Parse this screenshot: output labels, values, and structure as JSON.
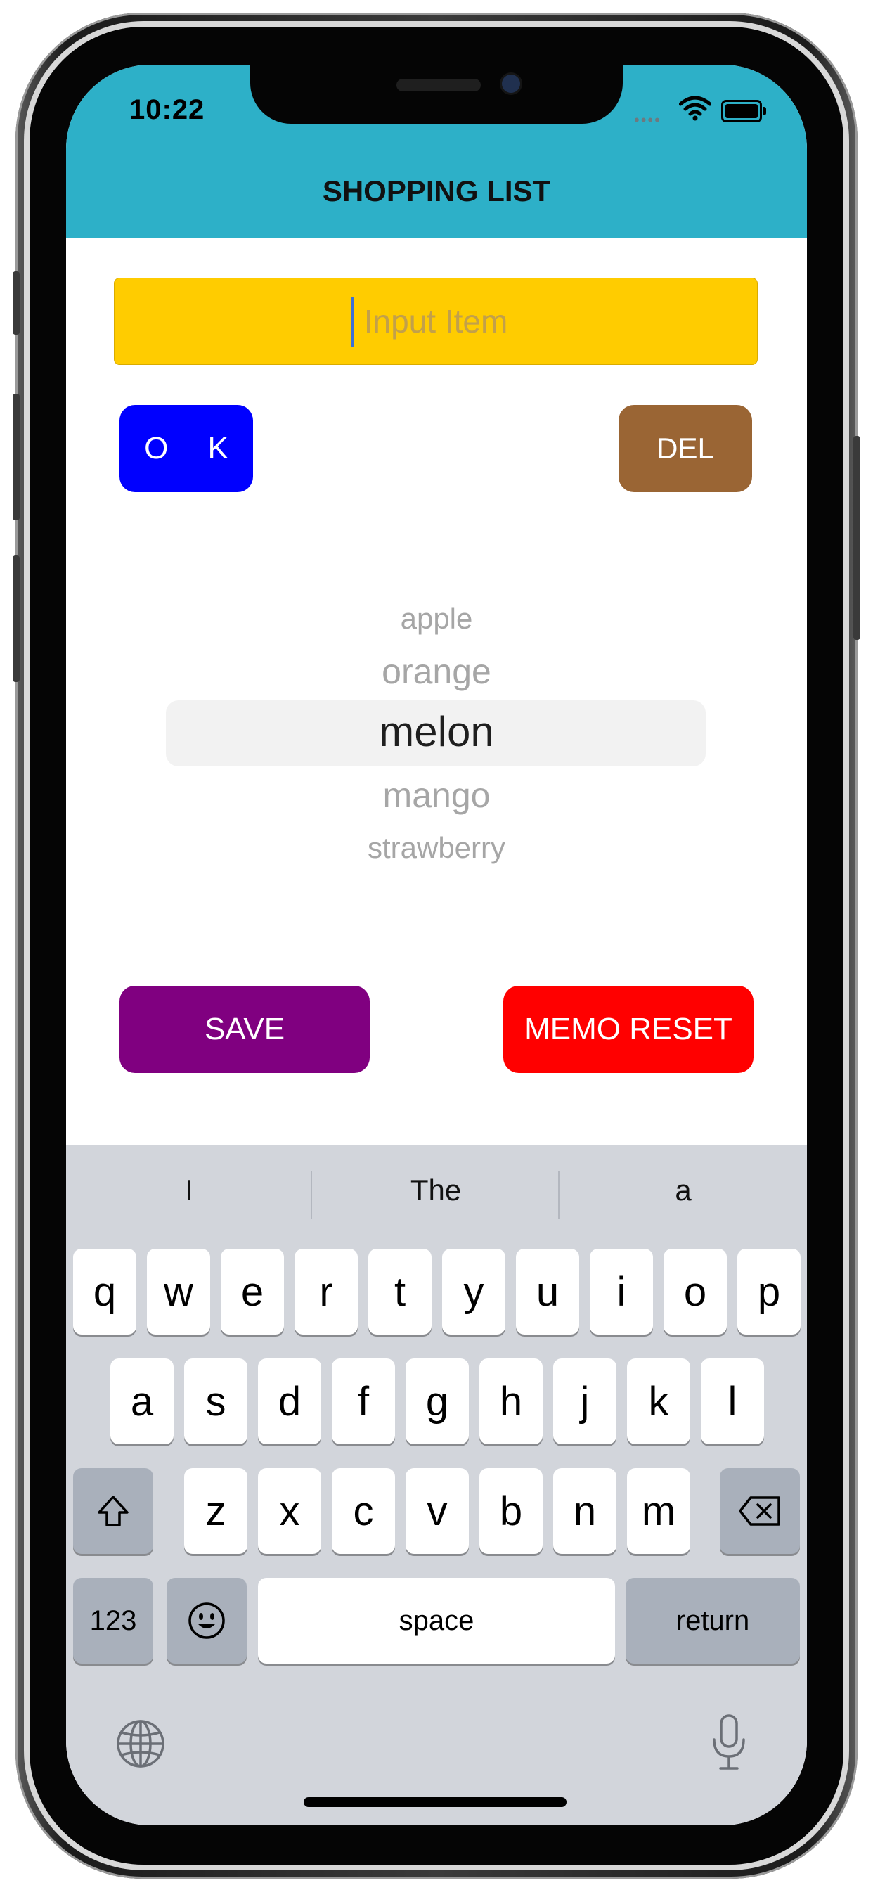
{
  "status_bar": {
    "time": "10:22",
    "signal": "••••"
  },
  "header": {
    "title": "SHOPPING LIST",
    "background": "#2db0c8"
  },
  "input": {
    "placeholder": "Input Item",
    "value": ""
  },
  "buttons": {
    "ok": "O K",
    "del": "DEL",
    "save": "SAVE",
    "memo_reset": "MEMO RESET"
  },
  "colors": {
    "input_bg": "#ffcc00",
    "ok": "#0000ff",
    "del": "#9a6534",
    "save": "#800080",
    "memo_reset": "#ff0000"
  },
  "picker": {
    "items": [
      "apple",
      "orange",
      "melon",
      "mango",
      "strawberry"
    ],
    "selected": "melon"
  },
  "keyboard": {
    "suggestions": [
      "I",
      "The",
      "a"
    ],
    "row1": [
      "q",
      "w",
      "e",
      "r",
      "t",
      "y",
      "u",
      "i",
      "o",
      "p"
    ],
    "row2": [
      "a",
      "s",
      "d",
      "f",
      "g",
      "h",
      "j",
      "k",
      "l"
    ],
    "row3": [
      "z",
      "x",
      "c",
      "v",
      "b",
      "n",
      "m"
    ],
    "numbers_key": "123",
    "space_key": "space",
    "return_key": "return",
    "icons": [
      "shift-icon",
      "backspace-icon",
      "emoji-icon",
      "globe-icon",
      "microphone-icon"
    ]
  }
}
